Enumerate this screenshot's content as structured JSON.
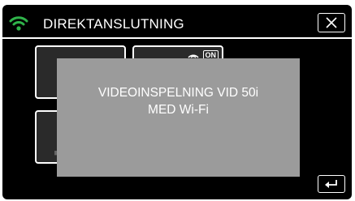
{
  "header": {
    "title": "DIREKTANSLUTNING",
    "wifi_icon": "wifi-icon",
    "close_icon": "close-icon"
  },
  "tiles": [
    {
      "name": "video-playback-tile",
      "icon": "play-icon"
    },
    {
      "name": "wifi-recording-tile",
      "icon": "wifi-on-icon",
      "badge": "ON"
    },
    {
      "name": "tile-3",
      "icon": "film-strip-icon"
    },
    {
      "name": "tile-4",
      "icon": "film-strip-icon"
    }
  ],
  "dialog": {
    "line1": "VIDEOINSPELNING VID 50i",
    "line2": "MED Wi-Fi"
  },
  "footer": {
    "back_icon": "return-icon"
  },
  "colors": {
    "background": "#000000",
    "dialog": "#9b9b9b",
    "wifi_green": "#2fb34a",
    "text": "#ffffff"
  }
}
